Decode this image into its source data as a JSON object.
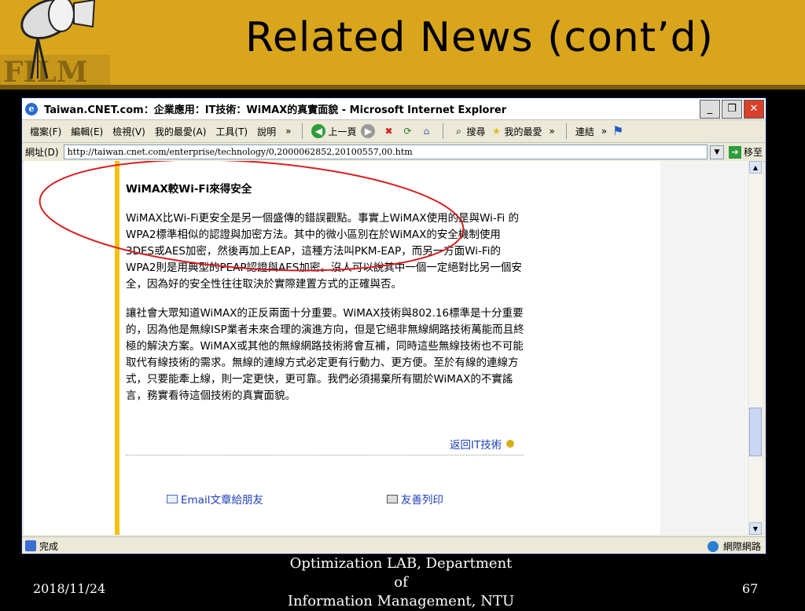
{
  "slide": {
    "title": "Related News (cont’d)",
    "footer_line1": "Optimization LAB, Department of",
    "footer_line2": "Information Management, NTU",
    "date": "2018/11/24",
    "page": "67",
    "colors": {
      "header": "#d8a51c",
      "background": "#000000",
      "title": "#000000",
      "footer_text": "#ffffff"
    }
  },
  "browser": {
    "window_title": "Taiwan.CNET.com：企業應用：IT技術：WiMAX的真實面貌 - Microsoft Internet Explorer",
    "menu": [
      "檔案(F)",
      "編輯(E)",
      "檢視(V)",
      "我的最愛(A)",
      "工具(T)",
      "說明"
    ],
    "toolbar": {
      "back": "上一頁",
      "search": "搜尋",
      "favorites": "我的最愛",
      "links": "連結",
      "chevron": "»"
    },
    "address": {
      "label": "網址(D)",
      "url": "http://taiwan.cnet.com/enterprise/technology/0,2000062852,20100557,00.htm",
      "go": "移至"
    },
    "status": {
      "text": "完成",
      "zone": "網際網路"
    }
  },
  "article": {
    "heading": "WiMAX較Wi-Fi來得安全",
    "para1": "WiMAX比Wi-Fi更安全是另一個盛傳的錯誤觀點。事實上WiMAX使用的是與Wi-Fi 的WPA2標準相似的認證與加密方法。其中的微小區別在於WiMAX的安全機制使用3DES或AES加密，然後再加上EAP，這種方法叫PKM-EAP，而另一方面Wi-Fi的WPA2則是用典型的PEAP認證與AES加密。沒人可以說其中一個一定絕對比另一個安全，因為好的安全性往往取決於實際建置方式的正確與否。",
    "para2": "讓社會大眾知道WiMAX的正反兩面十分重要。WiMAX技術與802.16標準是十分重要的，因為他是無線ISP業者未來合理的演進方向，但是它絕非無線網路技術萬能而且終極的解決方案。WiMAX或其他的無線網路技術將會互補，同時這些無線技術也不可能取代有線技術的需求。無線的連線方式必定更有行動力、更方便。至於有線的連線方式，只要能牽上線，則一定更快，更可靠。我們必須揚棄所有關於WiMAX的不實謠言，務實看待這個技術的真實面貌。",
    "back_link": "返回IT技術",
    "email_link": "Email文章給朋友",
    "print_link": "友善列印",
    "accent": "#f4c20d",
    "link_color": "#1d3fb8"
  },
  "annotation": {
    "shape": "oval",
    "color": "#d62020"
  }
}
